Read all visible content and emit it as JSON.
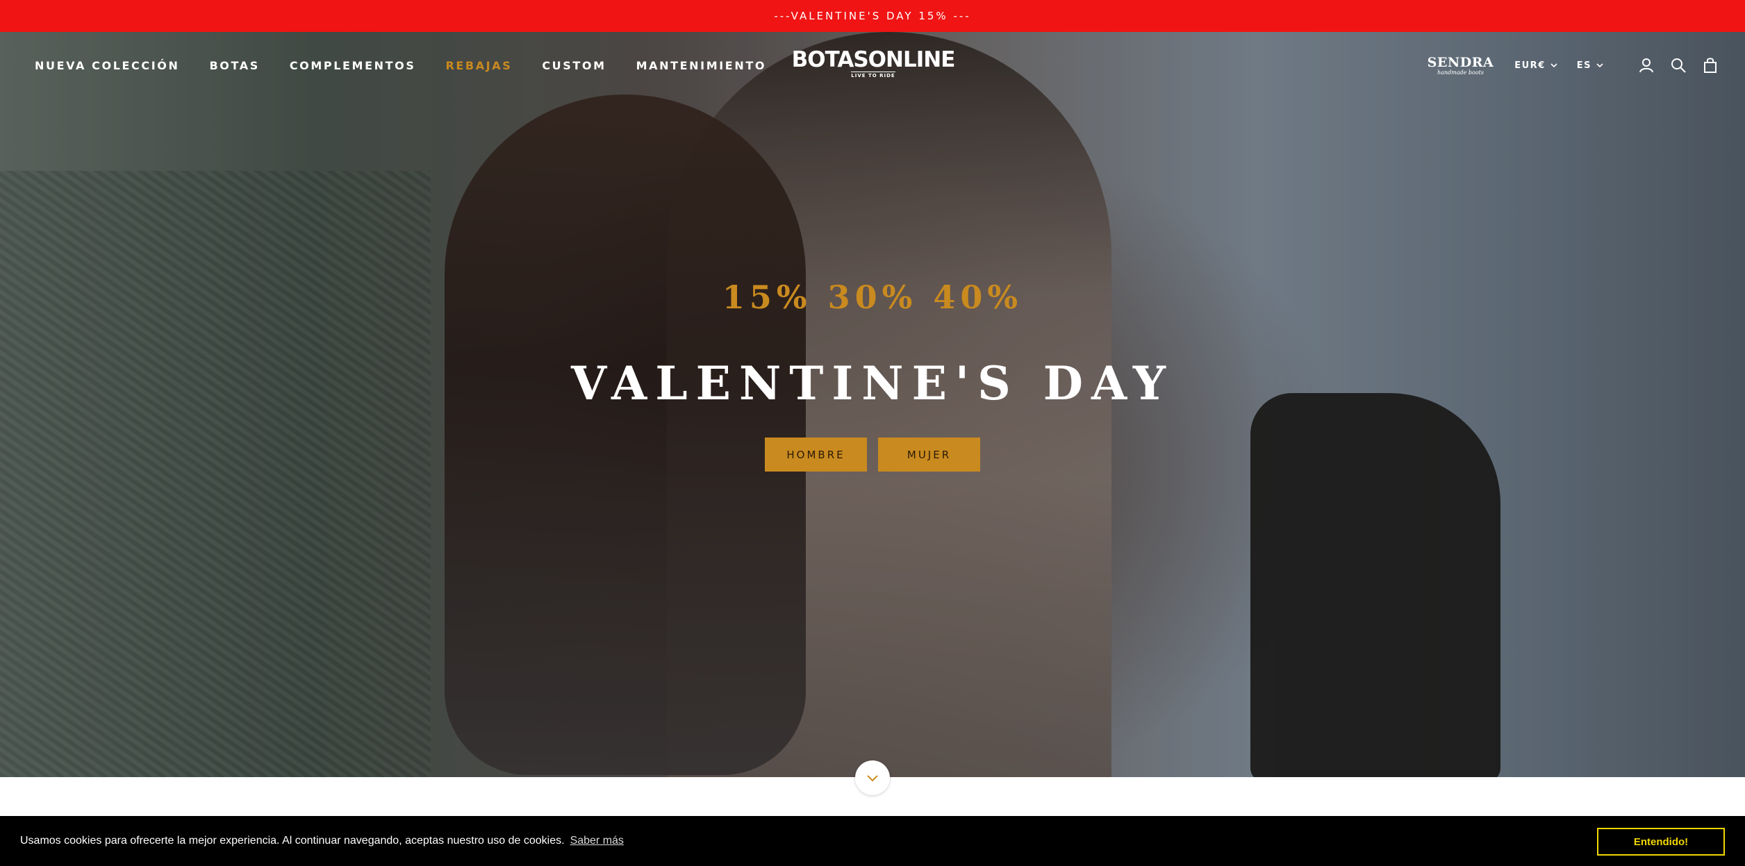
{
  "announcement": {
    "text": "---VALENTINE'S DAY 15% ---"
  },
  "nav": {
    "items": [
      {
        "label": "NUEVA COLECCIÓN"
      },
      {
        "label": "BOTAS"
      },
      {
        "label": "COMPLEMENTOS"
      },
      {
        "label": "REBAJAS",
        "active": true
      },
      {
        "label": "CUSTOM"
      },
      {
        "label": "MANTENIMIENTO"
      }
    ]
  },
  "logo": {
    "main": "BOTASONLINE",
    "tagline": "LIVE TO RIDE"
  },
  "tools": {
    "sendra": {
      "main": "SENDRA",
      "sub": "handmade boots"
    },
    "currency": "EUR€",
    "language": "ES",
    "icons": [
      "account-icon",
      "search-icon",
      "cart-icon"
    ]
  },
  "hero": {
    "subtitle": "15% 30% 40%",
    "title": "VALENTINE'S DAY",
    "buttons": [
      {
        "label": "HOMBRE"
      },
      {
        "label": "MUJER"
      }
    ],
    "scroll_icon": "chevron-down-icon"
  },
  "cookie": {
    "message": "Usamos cookies para ofrecerte la mejor experiencia. Al continuar navegando, aceptas nuestro uso de cookies.",
    "learn_more": "Saber más",
    "accept": "Entendido!"
  },
  "colors": {
    "announcement_bg": "#f01414",
    "accent_gold": "#c98a1f",
    "cookie_bg": "#000000",
    "cookie_accept": "#f1d600"
  }
}
